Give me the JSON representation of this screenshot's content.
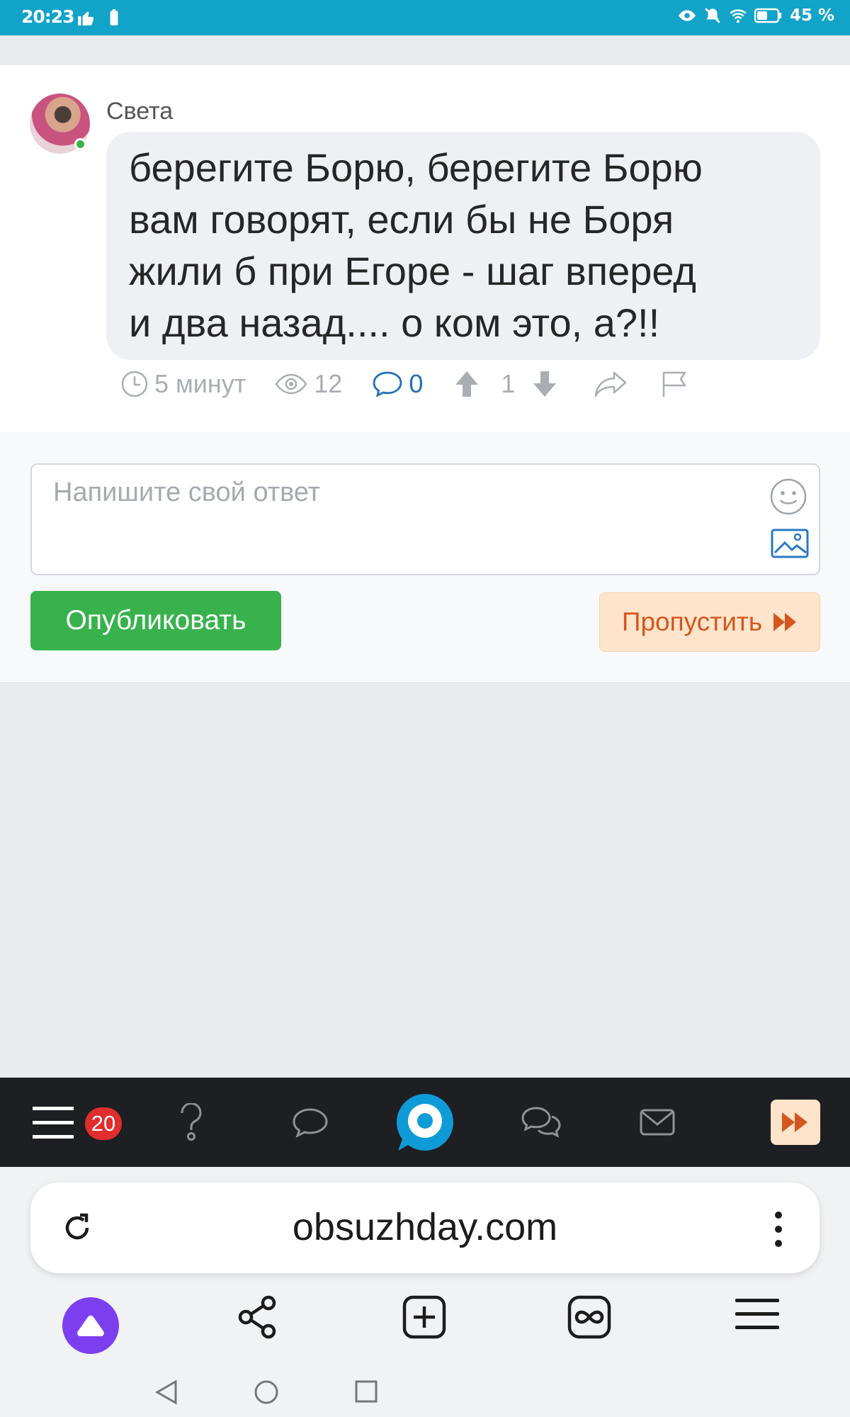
{
  "status_bar": {
    "time": "20:23",
    "battery": "45 %",
    "icons": [
      "thumb-up-icon",
      "battery-saver-icon",
      "eye-icon",
      "mute-icon",
      "wifi-icon",
      "battery-icon"
    ],
    "color": "#12a3c9"
  },
  "post": {
    "author": "Света",
    "text": "берегите Борю, берегите Борю\nвам говорят, если бы не Боря\nжили б при Егоре - шаг вперед\nи два назад.... о ком это, а?!!",
    "time_ago": "5 минут",
    "views": "12",
    "comments": "0",
    "rating": "1"
  },
  "reply": {
    "placeholder": "Напишите свой ответ",
    "publish_label": "Опубликовать",
    "skip_label": "Пропустить"
  },
  "site_nav": {
    "badge_count": "20",
    "items": [
      "menu-icon",
      "question-icon",
      "chat-icon",
      "home-logo-icon",
      "discussions-icon",
      "mail-icon",
      "skip-icon"
    ]
  },
  "browser": {
    "url": "obsuzhday.com",
    "toolbar": [
      "alice-icon",
      "share-icon",
      "new-tab-icon",
      "tabs-icon",
      "menu-icon"
    ]
  },
  "colors": {
    "accent_green": "#37b24d",
    "skip_orange": "#d4561e",
    "link_blue": "#1f6fb9",
    "nav_dark": "#1d1f22",
    "alice_purple": "#7c3ff0",
    "logo_blue": "#0f9bd7"
  }
}
